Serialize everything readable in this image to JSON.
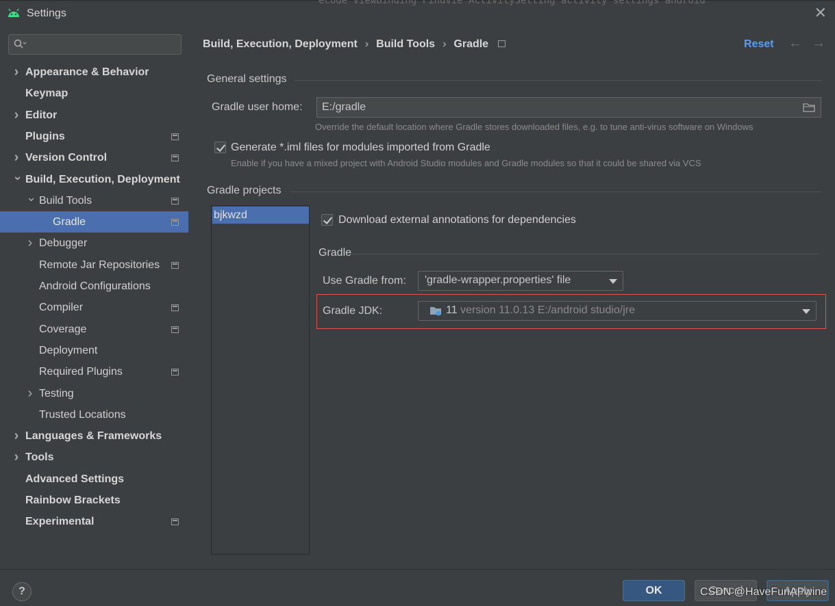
{
  "window": {
    "title": "Settings",
    "background_code": "ecode ViewBinding  Findvie ActivitySetting activity settings  android "
  },
  "sidebar": {
    "search": {
      "placeholder": ""
    },
    "items": [
      {
        "label": "Appearance & Behavior",
        "bold": true,
        "expandable": true,
        "expanded": false,
        "indent": 0,
        "has_project_icon": false
      },
      {
        "label": "Keymap",
        "bold": true,
        "expandable": false,
        "indent": 0,
        "has_project_icon": false
      },
      {
        "label": "Editor",
        "bold": true,
        "expandable": true,
        "expanded": false,
        "indent": 0,
        "has_project_icon": false
      },
      {
        "label": "Plugins",
        "bold": true,
        "expandable": false,
        "indent": 0,
        "has_project_icon": true
      },
      {
        "label": "Version Control",
        "bold": true,
        "expandable": true,
        "expanded": false,
        "indent": 0,
        "has_project_icon": true
      },
      {
        "label": "Build, Execution, Deployment",
        "bold": true,
        "expandable": true,
        "expanded": true,
        "indent": 0,
        "has_project_icon": false
      },
      {
        "label": "Build Tools",
        "bold": false,
        "expandable": true,
        "expanded": true,
        "indent": 1,
        "has_project_icon": true
      },
      {
        "label": "Gradle",
        "bold": false,
        "expandable": false,
        "indent": 2,
        "has_project_icon": true,
        "selected": true
      },
      {
        "label": "Debugger",
        "bold": false,
        "expandable": true,
        "expanded": false,
        "indent": 1,
        "has_project_icon": false
      },
      {
        "label": "Remote Jar Repositories",
        "bold": false,
        "expandable": false,
        "indent": 1,
        "has_project_icon": true
      },
      {
        "label": "Android Configurations",
        "bold": false,
        "expandable": false,
        "indent": 1,
        "has_project_icon": false
      },
      {
        "label": "Compiler",
        "bold": false,
        "expandable": false,
        "indent": 1,
        "has_project_icon": true
      },
      {
        "label": "Coverage",
        "bold": false,
        "expandable": false,
        "indent": 1,
        "has_project_icon": true
      },
      {
        "label": "Deployment",
        "bold": false,
        "expandable": false,
        "indent": 1,
        "has_project_icon": false
      },
      {
        "label": "Required Plugins",
        "bold": false,
        "expandable": false,
        "indent": 1,
        "has_project_icon": true
      },
      {
        "label": "Testing",
        "bold": false,
        "expandable": true,
        "expanded": false,
        "indent": 1,
        "has_project_icon": false
      },
      {
        "label": "Trusted Locations",
        "bold": false,
        "expandable": false,
        "indent": 1,
        "has_project_icon": false
      },
      {
        "label": "Languages & Frameworks",
        "bold": true,
        "expandable": true,
        "expanded": false,
        "indent": 0,
        "has_project_icon": false
      },
      {
        "label": "Tools",
        "bold": true,
        "expandable": true,
        "expanded": false,
        "indent": 0,
        "has_project_icon": false
      },
      {
        "label": "Advanced Settings",
        "bold": true,
        "expandable": false,
        "indent": 0,
        "has_project_icon": false
      },
      {
        "label": "Rainbow Brackets",
        "bold": true,
        "expandable": false,
        "indent": 0,
        "has_project_icon": false
      },
      {
        "label": "Experimental",
        "bold": true,
        "expandable": false,
        "indent": 0,
        "has_project_icon": true
      }
    ]
  },
  "breadcrumb": {
    "parts": [
      "Build, Execution, Deployment",
      "Build Tools",
      "Gradle"
    ],
    "separator": "›"
  },
  "header": {
    "reset_label": "Reset"
  },
  "general": {
    "title": "General settings",
    "gradle_home_label": "Gradle user home:",
    "gradle_home_value": "E:/gradle",
    "gradle_home_hint": "Override the default location where Gradle stores downloaded files, e.g. to tune anti-virus software on Windows",
    "iml_label": "Generate *.iml files for modules imported from Gradle",
    "iml_checked": true,
    "iml_hint": "Enable if you have a mixed project with Android Studio modules and Gradle modules so that it could be shared via VCS"
  },
  "projects": {
    "title": "Gradle projects",
    "list": [
      "bjkwzd"
    ],
    "download_annotations_label": "Download external annotations for dependencies",
    "download_annotations_checked": true,
    "gradle_subsection": "Gradle",
    "use_gradle_from_label": "Use Gradle from:",
    "use_gradle_from_value": "'gradle-wrapper.properties' file",
    "jdk_label": "Gradle JDK:",
    "jdk_version": "11",
    "jdk_detail": "version 11.0.13 E:/android studio/jre"
  },
  "footer": {
    "help_label": "?",
    "ok_label": "OK",
    "cancel_label": "Cancel",
    "apply_label": "Apply",
    "watermark": "CSDN @HaveFunAPwine"
  },
  "colors": {
    "selection": "#4b6eaf",
    "accent_link": "#589df6",
    "highlight_border": "#d9534f",
    "ok_button": "#365880"
  }
}
